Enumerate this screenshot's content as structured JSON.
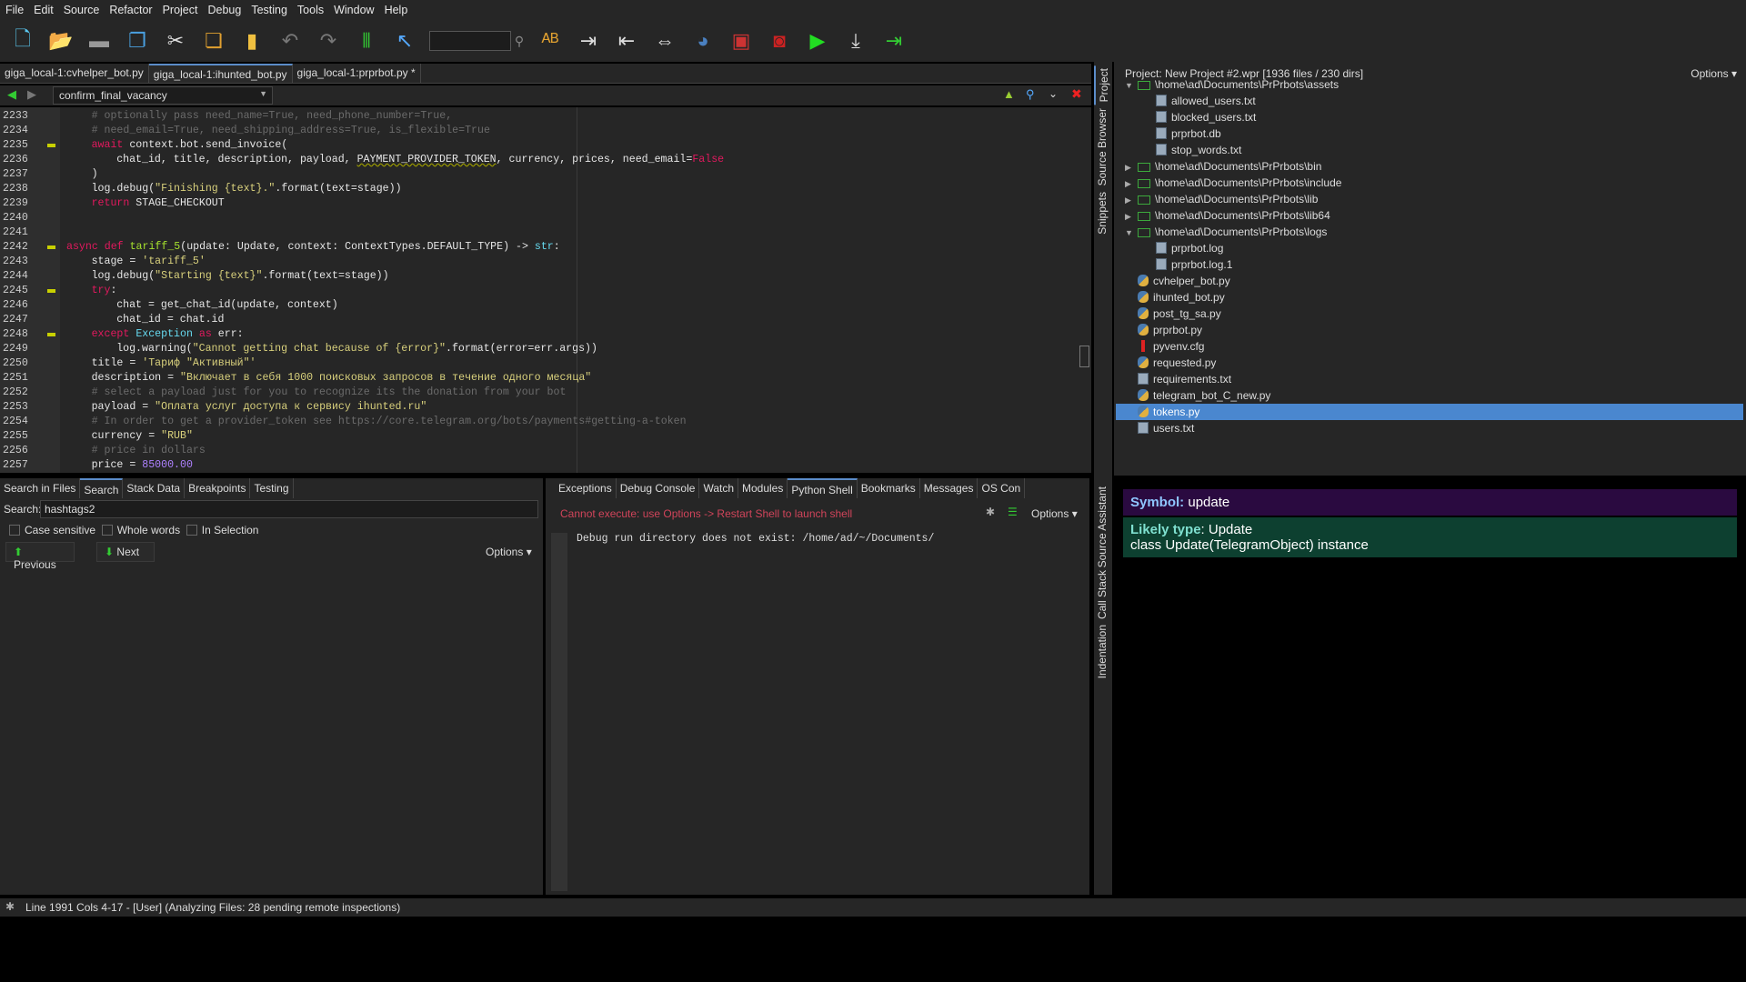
{
  "menu": [
    "File",
    "Edit",
    "Source",
    "Refactor",
    "Project",
    "Debug",
    "Testing",
    "Tools",
    "Window",
    "Help"
  ],
  "toolbar_icons": [
    "new-file-icon",
    "open-folder-icon",
    "save-icon",
    "save-all-icon",
    "cut-icon",
    "copy-icon",
    "paste-icon",
    "undo-icon",
    "redo-icon",
    "indent-guides-icon",
    "select-pointer-icon",
    "search-icon",
    "spell-check-icon",
    "indent-icon",
    "dedent-icon",
    "indent-swap-icon",
    "python-icon",
    "debug-tool-icon",
    "stop-icon",
    "run-icon",
    "step-into-icon",
    "step-out-icon"
  ],
  "file_tabs": [
    {
      "label": "giga_local-1:cvhelper_bot.py",
      "active": false
    },
    {
      "label": "giga_local-1:ihunted_bot.py",
      "active": true
    },
    {
      "label": "giga_local-1:prprbot.py *",
      "active": false
    }
  ],
  "editor": {
    "function_selector": "confirm_final_vacancy",
    "lines": [
      {
        "n": "2233",
        "i": 1,
        "t": [
          [
            "# optionally pass need_name=True, need_phone_number=True,",
            "cm"
          ]
        ]
      },
      {
        "n": "2234",
        "i": 1,
        "t": [
          [
            "# need_email=True, need_shipping_address=True, is_flexible=True",
            "cm"
          ]
        ]
      },
      {
        "n": "2235",
        "i": 1,
        "f": true,
        "t": [
          [
            "await",
            "kw"
          ],
          [
            " context.bot.send_invoice(",
            ""
          ]
        ]
      },
      {
        "n": "2236",
        "i": 2,
        "t": [
          [
            "chat_id, title, description, payload, ",
            ""
          ],
          [
            "PAYMENT_PROVIDER_TOKEN",
            "ul"
          ],
          [
            ", currency, prices, need_email=",
            ""
          ],
          [
            "False",
            "kw"
          ]
        ]
      },
      {
        "n": "2237",
        "i": 1,
        "t": [
          [
            ")",
            ""
          ]
        ]
      },
      {
        "n": "2238",
        "i": 1,
        "t": [
          [
            "log.debug(",
            ""
          ],
          [
            "\"Finishing {text}.\"",
            "str"
          ],
          [
            ".format(text=stage))",
            ""
          ]
        ]
      },
      {
        "n": "2239",
        "i": 1,
        "t": [
          [
            "return",
            "kw"
          ],
          [
            " STAGE_CHECKOUT",
            ""
          ]
        ]
      },
      {
        "n": "2240",
        "i": 0,
        "t": []
      },
      {
        "n": "2241",
        "i": 0,
        "t": []
      },
      {
        "n": "2242",
        "i": -1,
        "f": true,
        "t": [
          [
            "async def",
            "kw"
          ],
          [
            " ",
            ""
          ],
          [
            "tariff_5",
            "fn"
          ],
          [
            "(update: Update, context: ContextTypes.DEFAULT_TYPE) -> ",
            ""
          ],
          [
            "str",
            "bi"
          ],
          [
            ":",
            ""
          ]
        ]
      },
      {
        "n": "2243",
        "i": 1,
        "t": [
          [
            "stage = ",
            ""
          ],
          [
            "'tariff_5'",
            "str"
          ]
        ]
      },
      {
        "n": "2244",
        "i": 1,
        "t": [
          [
            "log.debug(",
            ""
          ],
          [
            "\"Starting {text}\"",
            "str"
          ],
          [
            ".format(text=stage))",
            ""
          ]
        ]
      },
      {
        "n": "2245",
        "i": 1,
        "f": true,
        "t": [
          [
            "try",
            "kw"
          ],
          [
            ":",
            ""
          ]
        ]
      },
      {
        "n": "2246",
        "i": 2,
        "t": [
          [
            "chat = get_chat_id(update, context)",
            ""
          ]
        ]
      },
      {
        "n": "2247",
        "i": 2,
        "t": [
          [
            "chat_id = chat.id",
            ""
          ]
        ]
      },
      {
        "n": "2248",
        "i": 1,
        "f": true,
        "t": [
          [
            "except",
            "kw"
          ],
          [
            " ",
            ""
          ],
          [
            "Exception",
            "bi"
          ],
          [
            " ",
            ""
          ],
          [
            "as",
            "kw"
          ],
          [
            " err:",
            ""
          ]
        ]
      },
      {
        "n": "2249",
        "i": 2,
        "t": [
          [
            "log.warning(",
            ""
          ],
          [
            "\"Cannot getting chat because of {error}\"",
            "str"
          ],
          [
            ".format(error=err.args))",
            ""
          ]
        ]
      },
      {
        "n": "2250",
        "i": 1,
        "t": [
          [
            "title = ",
            ""
          ],
          [
            "'Тариф \"Активный\"'",
            "str"
          ]
        ]
      },
      {
        "n": "2251",
        "i": 1,
        "t": [
          [
            "description = ",
            ""
          ],
          [
            "\"Включает в себя 1000 поисковых запросов в течение одного месяца\"",
            "str"
          ]
        ]
      },
      {
        "n": "2252",
        "i": 1,
        "t": [
          [
            "# select a payload just for you to recognize its the donation from your bot",
            "cm"
          ]
        ]
      },
      {
        "n": "2253",
        "i": 1,
        "t": [
          [
            "payload = ",
            ""
          ],
          [
            "\"Оплата услуг доступа к сервису ihunted.ru\"",
            "str"
          ]
        ]
      },
      {
        "n": "2254",
        "i": 1,
        "t": [
          [
            "# In order to get a provider_token see https://core.telegram.org/bots/payments#getting-a-token",
            "cm"
          ]
        ]
      },
      {
        "n": "2255",
        "i": 1,
        "t": [
          [
            "currency = ",
            ""
          ],
          [
            "\"RUB\"",
            "str"
          ]
        ]
      },
      {
        "n": "2256",
        "i": 1,
        "t": [
          [
            "# price in dollars",
            "cm"
          ]
        ]
      },
      {
        "n": "2257",
        "i": 1,
        "t": [
          [
            "price = ",
            ""
          ],
          [
            "85000.00",
            "num"
          ]
        ]
      }
    ]
  },
  "side_tabs_top": [
    "Project",
    "Source Browser",
    "Snippets"
  ],
  "side_tabs_bottom": [
    "Source Assistant",
    "Call Stack",
    "Indentation"
  ],
  "project": {
    "header": "Project: New Project #2.wpr [1936 files / 230 dirs]",
    "options": "Options",
    "tree": [
      {
        "label": "\\home\\ad\\Documents\\PrPrbots\\assets",
        "type": "folder",
        "level": 0,
        "expanded": true
      },
      {
        "label": "allowed_users.txt",
        "type": "file",
        "level": 1
      },
      {
        "label": "blocked_users.txt",
        "type": "file",
        "level": 1
      },
      {
        "label": "prprbot.db",
        "type": "file",
        "level": 1
      },
      {
        "label": "stop_words.txt",
        "type": "file",
        "level": 1
      },
      {
        "label": "\\home\\ad\\Documents\\PrPrbots\\bin",
        "type": "folder",
        "level": 0,
        "expanded": false
      },
      {
        "label": "\\home\\ad\\Documents\\PrPrbots\\include",
        "type": "folder",
        "level": 0,
        "expanded": false
      },
      {
        "label": "\\home\\ad\\Documents\\PrPrbots\\lib",
        "type": "folder",
        "level": 0,
        "expanded": false
      },
      {
        "label": "\\home\\ad\\Documents\\PrPrbots\\lib64",
        "type": "folder",
        "level": 0,
        "expanded": false
      },
      {
        "label": "\\home\\ad\\Documents\\PrPrbots\\logs",
        "type": "folder",
        "level": 0,
        "expanded": true
      },
      {
        "label": "prprbot.log",
        "type": "file",
        "level": 1
      },
      {
        "label": "prprbot.log.1",
        "type": "file",
        "level": 1
      },
      {
        "label": "cvhelper_bot.py",
        "type": "py",
        "level": 0
      },
      {
        "label": "ihunted_bot.py",
        "type": "py",
        "level": 0
      },
      {
        "label": "post_tg_sa.py",
        "type": "py",
        "level": 0
      },
      {
        "label": "prprbot.py",
        "type": "py",
        "level": 0
      },
      {
        "label": "pyvenv.cfg",
        "type": "cfg",
        "level": 0
      },
      {
        "label": "requested.py",
        "type": "py",
        "level": 0
      },
      {
        "label": "requirements.txt",
        "type": "file",
        "level": 0
      },
      {
        "label": "telegram_bot_C_new.py",
        "type": "py",
        "level": 0
      },
      {
        "label": "tokens.py",
        "type": "py",
        "level": 0,
        "selected": true
      },
      {
        "label": "users.txt",
        "type": "file",
        "level": 0
      }
    ]
  },
  "assistant": {
    "symbol_label": "Symbol:",
    "symbol": "update",
    "type_label": "Likely type",
    "type_value": ": Update",
    "type_desc": "class Update(TelegramObject) instance"
  },
  "bottom_left_tabs": [
    {
      "label": "Search in Files"
    },
    {
      "label": "Search",
      "active": true
    },
    {
      "label": "Stack Data"
    },
    {
      "label": "Breakpoints"
    },
    {
      "label": "Testing"
    }
  ],
  "bottom_right_tabs": [
    {
      "label": "Exceptions"
    },
    {
      "label": "Debug Console"
    },
    {
      "label": "Watch"
    },
    {
      "label": "Modules"
    },
    {
      "label": "Python Shell",
      "active": true
    },
    {
      "label": "Bookmarks"
    },
    {
      "label": "Messages"
    },
    {
      "label": "OS Con"
    }
  ],
  "search": {
    "label": "Search:",
    "value": "hashtags2",
    "case_sensitive": "Case sensitive",
    "whole_words": "Whole words",
    "in_selection": "In Selection",
    "previous": "Previous",
    "next": "Next",
    "options": "Options"
  },
  "shell": {
    "error": "Cannot execute: use Options -> Restart Shell to launch shell",
    "options": "Options",
    "output": "Debug run directory does not exist: /home/ad/~/Documents/"
  },
  "status": "Line 1991 Cols 4-17 - [User] (Analyzing Files:  28 pending remote inspections)"
}
